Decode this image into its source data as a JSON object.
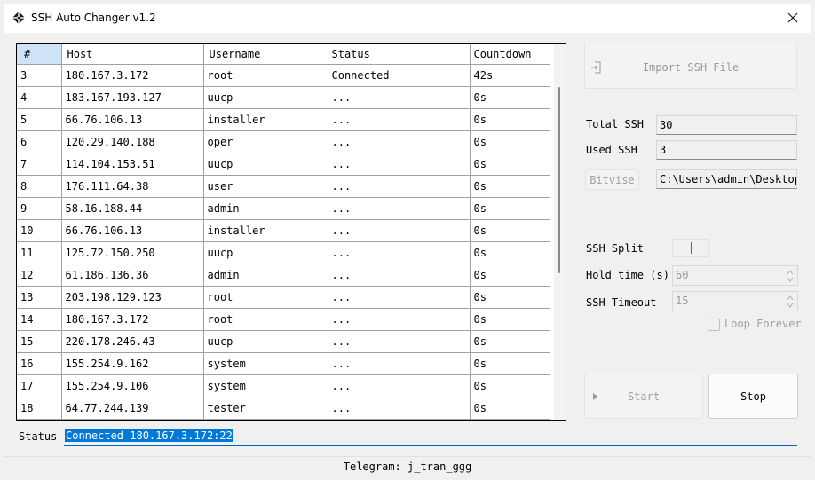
{
  "window": {
    "title": "SSH Auto Changer v1.2"
  },
  "table": {
    "columns": [
      "#",
      "Host",
      "Username",
      "Status",
      "Countdown"
    ],
    "rows": [
      [
        "3",
        "180.167.3.172",
        "root",
        "Connected",
        "42s"
      ],
      [
        "4",
        "183.167.193.127",
        "uucp",
        "...",
        "0s"
      ],
      [
        "5",
        "66.76.106.13",
        "installer",
        "...",
        "0s"
      ],
      [
        "6",
        "120.29.140.188",
        "oper",
        "...",
        "0s"
      ],
      [
        "7",
        "114.104.153.51",
        "uucp",
        "...",
        "0s"
      ],
      [
        "8",
        "176.111.64.38",
        "user",
        "...",
        "0s"
      ],
      [
        "9",
        "58.16.188.44",
        "admin",
        "...",
        "0s"
      ],
      [
        "10",
        "66.76.106.13",
        "installer",
        "...",
        "0s"
      ],
      [
        "11",
        "125.72.150.250",
        "uucp",
        "...",
        "0s"
      ],
      [
        "12",
        "61.186.136.36",
        "admin",
        "...",
        "0s"
      ],
      [
        "13",
        "203.198.129.123",
        "root",
        "...",
        "0s"
      ],
      [
        "14",
        "180.167.3.172",
        "root",
        "...",
        "0s"
      ],
      [
        "15",
        "220.178.246.43",
        "uucp",
        "...",
        "0s"
      ],
      [
        "16",
        "155.254.9.162",
        "system",
        "...",
        "0s"
      ],
      [
        "17",
        "155.254.9.106",
        "system",
        "...",
        "0s"
      ],
      [
        "18",
        "64.77.244.139",
        "tester",
        "...",
        "0s"
      ]
    ]
  },
  "panel": {
    "import_label": "Import SSH File",
    "total_ssh_label": "Total SSH",
    "total_ssh_value": "30",
    "used_ssh_label": "Used SSH",
    "used_ssh_value": "3",
    "bitvise_label": "Bitvise",
    "bitvise_path": "C:\\Users\\admin\\Desktop",
    "ssh_split_label": "SSH Split",
    "hold_time_label": "Hold time (s)",
    "hold_time_value": "60",
    "ssh_timeout_label": "SSH Timeout",
    "ssh_timeout_value": "15",
    "loop_forever_label": "Loop Forever",
    "loop_forever_checked": false,
    "start_label": "Start",
    "stop_label": "Stop"
  },
  "status": {
    "label": "Status",
    "value": "Connected 180.167.3.172:22"
  },
  "footer": {
    "text": "Telegram: j_tran_ggg"
  },
  "colors": {
    "accent": "#0078d7",
    "header_selected": "#cfe3f7"
  },
  "icons": [
    "app-logo-icon",
    "close-icon",
    "import-file-icon",
    "play-icon",
    "spin-up-icon",
    "spin-down-icon"
  ]
}
